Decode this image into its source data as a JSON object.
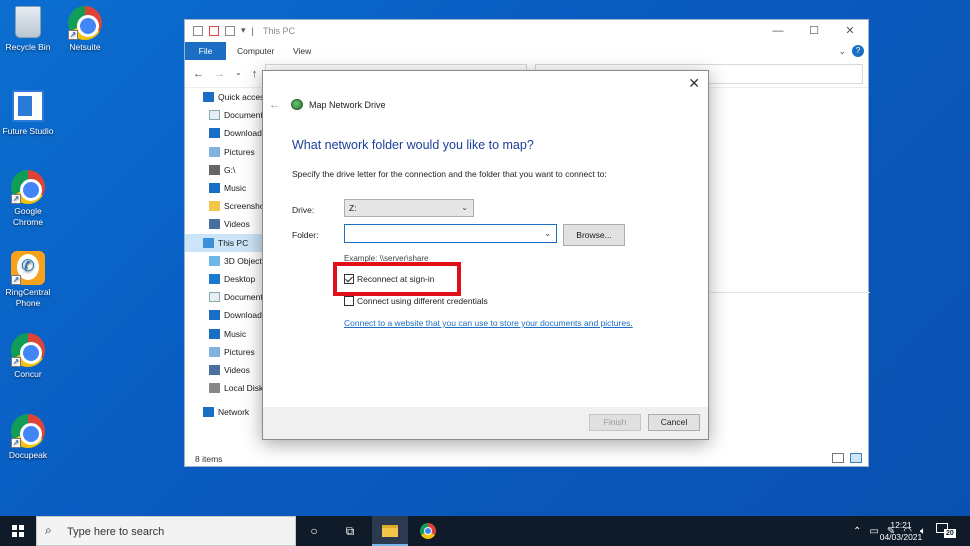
{
  "desktop": {
    "icons": [
      {
        "label": "Recycle Bin"
      },
      {
        "label": "Netsuite"
      },
      {
        "label": "Future Studio"
      },
      {
        "label": "Google Chrome"
      },
      {
        "label": "RingCentral Phone"
      },
      {
        "label": "Concur"
      },
      {
        "label": "Docupeak"
      }
    ]
  },
  "explorer": {
    "title": "This PC",
    "ribbon_tabs": [
      "File",
      "Computer",
      "View"
    ],
    "nav_items": [
      {
        "label": "Quick access",
        "icon": "star-icon"
      },
      {
        "label": "Documents",
        "icon": "documents-icon"
      },
      {
        "label": "Downloads",
        "icon": "downloads-icon"
      },
      {
        "label": "Pictures",
        "icon": "pictures-icon"
      },
      {
        "label": "G:\\",
        "icon": "drive-icon"
      },
      {
        "label": "Music",
        "icon": "music-icon"
      },
      {
        "label": "Screenshots",
        "icon": "folder-icon"
      },
      {
        "label": "Videos",
        "icon": "videos-icon"
      },
      {
        "label": "This PC",
        "icon": "pc-icon"
      },
      {
        "label": "3D Objects",
        "icon": "3d-objects-icon"
      },
      {
        "label": "Desktop",
        "icon": "desktop-icon"
      },
      {
        "label": "Documents",
        "icon": "documents-icon"
      },
      {
        "label": "Downloads",
        "icon": "downloads-icon"
      },
      {
        "label": "Music",
        "icon": "music-icon"
      },
      {
        "label": "Pictures",
        "icon": "pictures-icon"
      },
      {
        "label": "Videos",
        "icon": "videos-icon"
      },
      {
        "label": "Local Disk",
        "icon": "disk-icon"
      },
      {
        "label": "Network",
        "icon": "network-icon"
      }
    ],
    "status": "8 items"
  },
  "dialog": {
    "title": "Map Network Drive",
    "heading": "What network folder would you like to map?",
    "description": "Specify the drive letter for the connection and the folder that you want to connect to:",
    "drive_label": "Drive:",
    "drive_value": "Z:",
    "folder_label": "Folder:",
    "folder_value": "",
    "browse_label": "Browse...",
    "example": "Example: \\\\server\\share",
    "reconnect_label": "Reconnect at sign-in",
    "reconnect_checked": true,
    "credentials_label": "Connect using different credentials",
    "credentials_checked": false,
    "link_text": "Connect to a website that you can use to store your documents and pictures",
    "link_suffix": ".",
    "finish_label": "Finish",
    "cancel_label": "Cancel"
  },
  "taskbar": {
    "search_placeholder": "Type here to search",
    "time": "12:21",
    "date": "04/03/2021",
    "notification_count": "20"
  },
  "colors": {
    "desktop_bg": "#0a5cc1",
    "accent": "#1a6fc4",
    "heading": "#1c3f9a",
    "highlight": "#e0101a",
    "taskbar": "#101b29"
  }
}
